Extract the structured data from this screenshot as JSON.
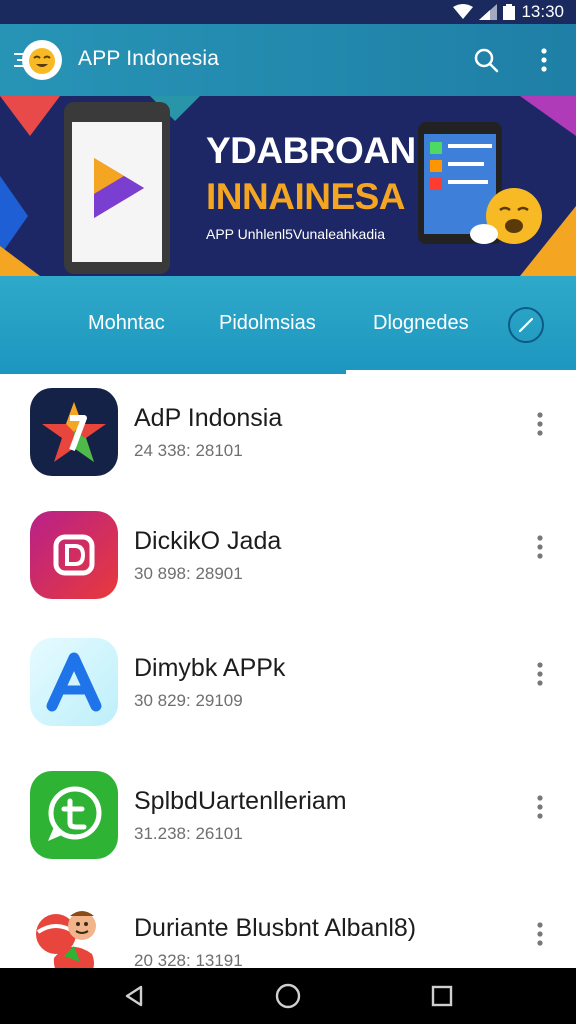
{
  "status_bar": {
    "time": "13:30"
  },
  "app_bar": {
    "title": "APP Indonesia"
  },
  "banner": {
    "title": "YDABROAN",
    "subtitle": "INNAINESA",
    "caption": "APP Unhlenl5Vunaleahkadia"
  },
  "tabs": [
    {
      "label": "Mohntac"
    },
    {
      "label": "Pidolmsias"
    },
    {
      "label": "Dlognedes",
      "selected": true
    }
  ],
  "apps": [
    {
      "name": "AdP Indonsia",
      "meta": "24 338: 28101",
      "icon": "star-logo-icon"
    },
    {
      "name": "DickikO Jada",
      "meta": "30 898: 28901",
      "icon": "d-letter-icon"
    },
    {
      "name": "Dimybk APPk",
      "meta": "30 829: 29109",
      "icon": "a-letter-icon"
    },
    {
      "name": "SplbdUartenlleriam",
      "meta": "31.238: 26101",
      "icon": "chat-bubble-icon"
    },
    {
      "name": "Duriante Blusbnt Albanl8)",
      "meta": "20 328: 13191",
      "icon": "cartoon-character-icon"
    }
  ],
  "colors": {
    "app_bar": "#2794b6",
    "tabs": "#1d96bf",
    "banner": "#1d2766",
    "banner_accent": "#f4a623"
  }
}
